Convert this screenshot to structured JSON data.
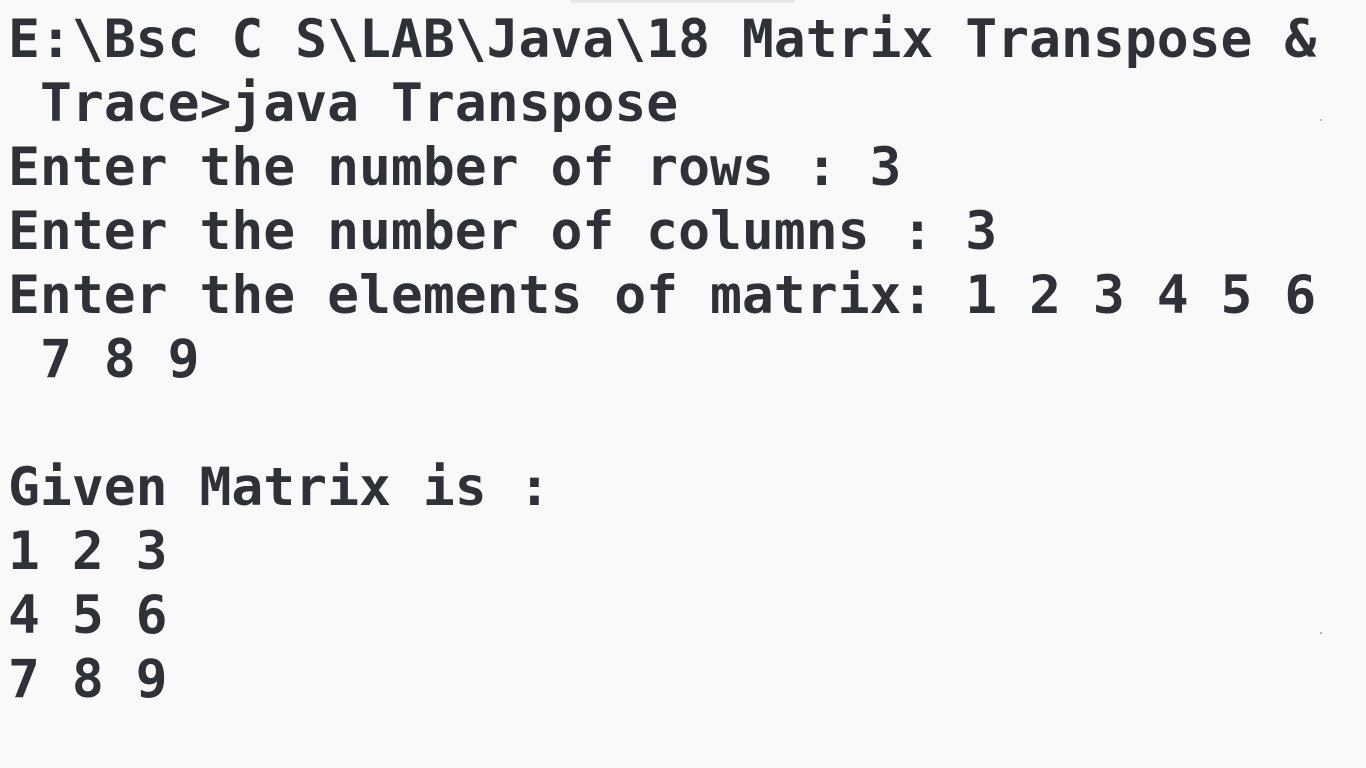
{
  "terminal": {
    "lines": [
      "E:\\Bsc C S\\LAB\\Java\\18 Matrix Transpose &",
      "Trace>java Transpose",
      "Enter the number of rows : 3",
      "Enter the number of columns : 3",
      "Enter the elements of matrix: 1 2 3 4 5 6",
      "7 8 9",
      "",
      "Given Matrix is :",
      "1 2 3",
      "4 5 6",
      "7 8 9"
    ]
  },
  "colors": {
    "background": "#f9f9f9",
    "text": "#2e3138"
  }
}
